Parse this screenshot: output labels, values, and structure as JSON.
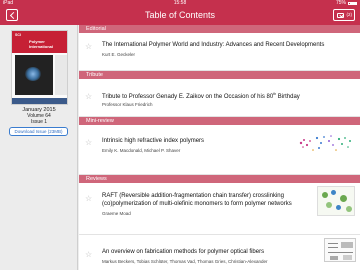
{
  "status_bar": {
    "carrier": "iPad",
    "time": "15:58",
    "battery": "75%"
  },
  "nav": {
    "title": "Table of Contents",
    "download_count": "(2)"
  },
  "cover": {
    "logo": "SCI",
    "journal_name": "Polymer International"
  },
  "issue": {
    "date": "January 2015",
    "volume": "Volume 64",
    "issue": "Issue 1",
    "download_label": "Download Issue (23MB)"
  },
  "sections": [
    {
      "header": "Editorial",
      "articles": [
        {
          "title": "The International Polymer World and Industry: Advances and Recent Developments",
          "authors": "Kurt E. Geckeler"
        }
      ]
    },
    {
      "header": "Tribute",
      "articles": [
        {
          "title_prefix": "Tribute to Professor Genady E. Zaikov on the Occasion of his 80",
          "title_sup": "th",
          "title_suffix": " Birthday",
          "authors": "Professor Klaus Friedrich"
        }
      ]
    },
    {
      "header": "Mini-review",
      "articles": [
        {
          "title": "Intrinsic high refractive index polymers",
          "authors": "Emily K. Macdonald, Michael P. Shaver"
        }
      ]
    },
    {
      "header": "Reviews",
      "articles": [
        {
          "title_line1": "RAFT (Reversible addition-fragmentation chain transfer) crosslinking",
          "title_line2": "(co)polymerization of multi-olefinic monomers to form polymer networks",
          "authors": "Graeme Moad"
        },
        {
          "title": "An overview on fabrication methods for polymer optical fibers",
          "authors": "Markus Beckers, Tobias Schlüter, Thomas Vad, Thomas Gries, Christian-Alexander"
        }
      ]
    }
  ]
}
